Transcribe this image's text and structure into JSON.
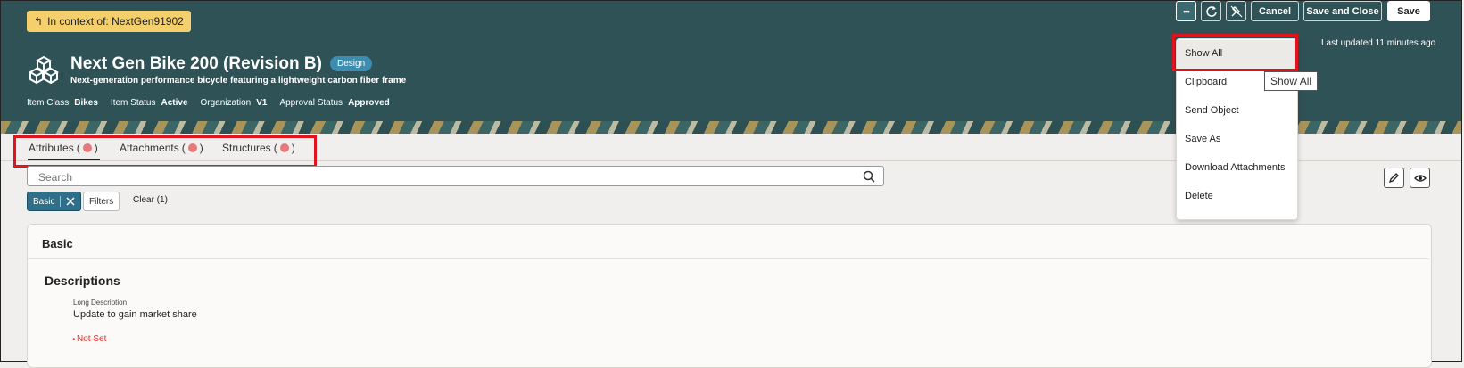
{
  "context_chip": {
    "icon": "arrow-up-left-icon",
    "label": "In context of: NextGen91902"
  },
  "item": {
    "title": "Next Gen Bike 200 (Revision B)",
    "badge": "Design",
    "subtitle": "Next-generation performance bicycle featuring a lightweight carbon fiber frame",
    "meta": [
      {
        "label": "Item Class",
        "value": "Bikes"
      },
      {
        "label": "Item Status",
        "value": "Active"
      },
      {
        "label": "Organization",
        "value": "V1"
      },
      {
        "label": "Approval Status",
        "value": "Approved"
      }
    ]
  },
  "toolbar": {
    "more_label": "•••",
    "cancel_label": "Cancel",
    "save_close_label": "Save and Close",
    "save_label": "Save",
    "last_updated": "Last updated 11 minutes ago"
  },
  "tabs": [
    {
      "label": "Attributes",
      "open": "(",
      "close": ")"
    },
    {
      "label": "Attachments",
      "open": "(",
      "close": ")"
    },
    {
      "label": "Structures",
      "open": "(",
      "close": ")"
    }
  ],
  "search": {
    "placeholder": "Search"
  },
  "filters": {
    "basic_label": "Basic",
    "filters_label": "Filters",
    "clear_label": "Clear (1)"
  },
  "panel": {
    "title": "Basic",
    "section_title": "Descriptions",
    "long_desc_label": "Long Description",
    "long_desc_value": "Update to gain market share",
    "not_set_bullet": "•",
    "not_set": "Not Set"
  },
  "menu": {
    "items": [
      "Show All",
      "Clipboard",
      "Send Object",
      "Save As",
      "Download Attachments",
      "Delete"
    ],
    "tooltip": "Show All"
  },
  "colors": {
    "header_bg": "#2f5257",
    "accent_red": "#e2131c",
    "context_chip": "#f5cf6c",
    "badge": "#3d8db1"
  }
}
